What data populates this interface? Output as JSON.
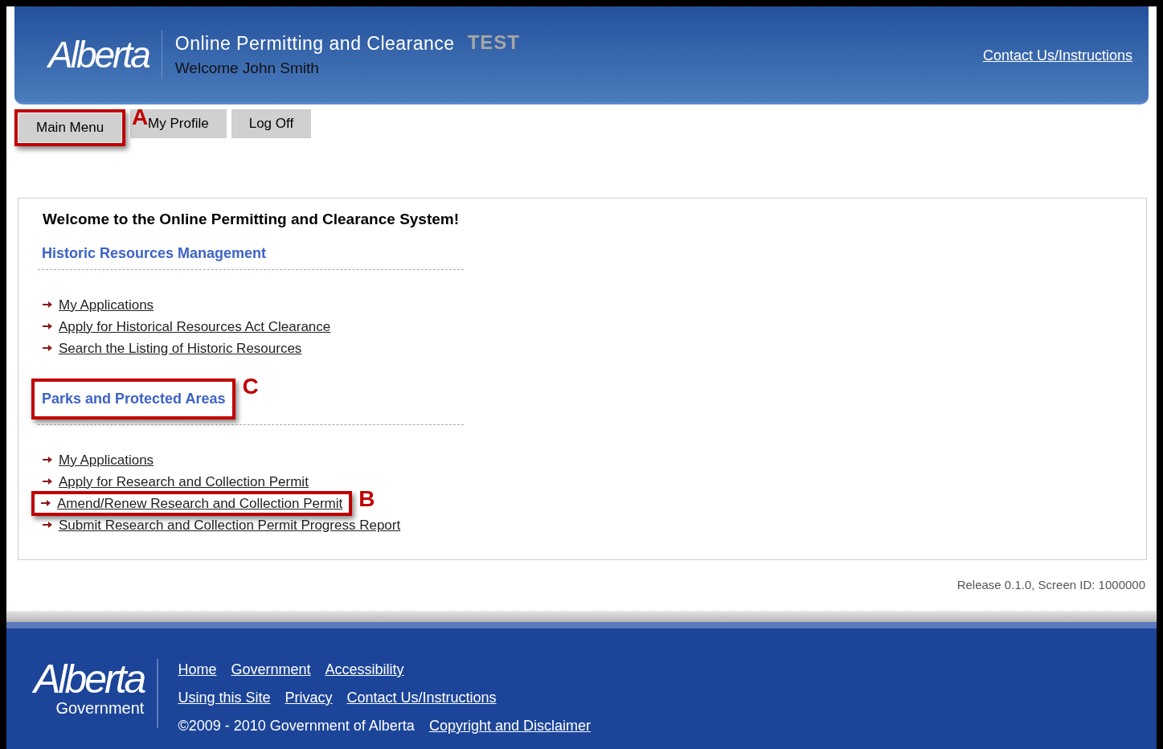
{
  "header": {
    "logo": "Alberta",
    "title": "Online Permitting and Clearance",
    "badge": "TEST",
    "welcome": "Welcome John Smith",
    "contact_link": "Contact Us/Instructions"
  },
  "nav": [
    {
      "label": "Main Menu",
      "annotation": "A"
    },
    {
      "label": "My Profile"
    },
    {
      "label": "Log Off"
    }
  ],
  "panel": {
    "heading": "Welcome to the Online Permitting and Clearance System!",
    "sections": [
      {
        "title": "Historic Resources Management",
        "links": [
          {
            "label": "My Applications"
          },
          {
            "label": "Apply for Historical Resources Act Clearance"
          },
          {
            "label": "Search the Listing of Historic Resources"
          }
        ]
      },
      {
        "title": "Parks and Protected Areas",
        "annotation": "C",
        "links": [
          {
            "label": "My Applications"
          },
          {
            "label": "Apply for Research and Collection Permit"
          },
          {
            "label": "Amend/Renew Research and Collection Permit",
            "annotation": "B"
          },
          {
            "label": "Submit Research and Collection Permit Progress Report"
          }
        ]
      }
    ]
  },
  "release": "Release 0.1.0, Screen ID: 1000000",
  "footer": {
    "logo": "Alberta",
    "logo_sub": "Government",
    "link_rows": [
      [
        "Home",
        "Government",
        "Accessibility"
      ],
      [
        "Using this Site",
        "Privacy",
        "Contact Us/Instructions"
      ]
    ],
    "copyright": "©2009 - 2010 Government of Alberta",
    "disclaimer_link": "Copyright and Disclaimer"
  }
}
